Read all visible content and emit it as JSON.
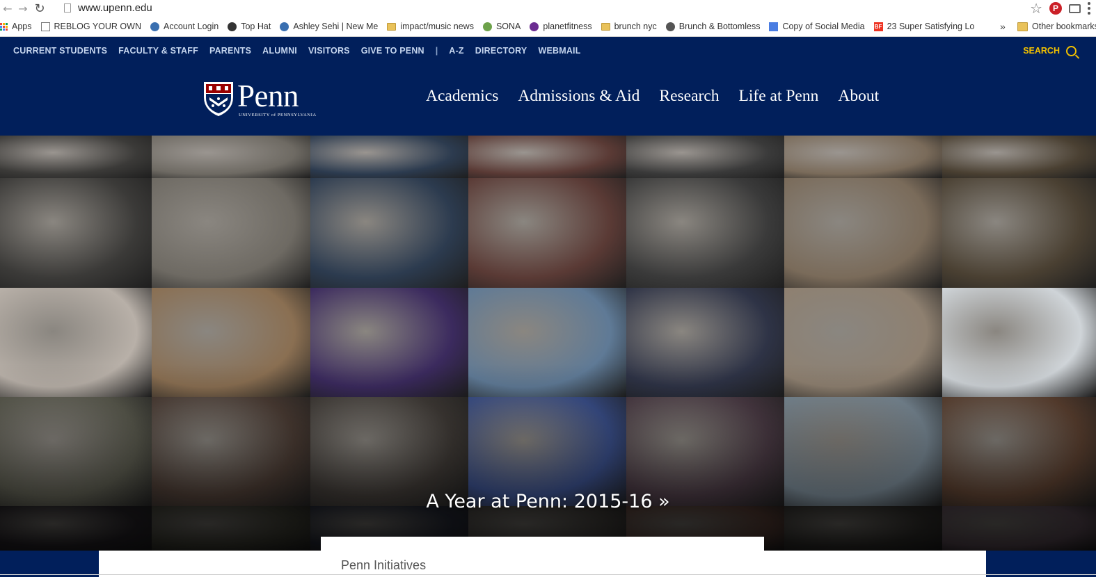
{
  "browser": {
    "url": "www.upenn.edu",
    "bookmarks": [
      {
        "label": "Apps",
        "icon": "apps-grid-icon"
      },
      {
        "label": "REBLOG YOUR OWN",
        "icon": "page-icon"
      },
      {
        "label": "Account Login",
        "icon": "globe-icon"
      },
      {
        "label": "Top Hat",
        "icon": "tophat-icon"
      },
      {
        "label": "Ashley Sehi | New Me",
        "icon": "globe-icon"
      },
      {
        "label": "impact/music news",
        "icon": "folder-icon"
      },
      {
        "label": "SONA",
        "icon": "sona-icon"
      },
      {
        "label": "planetfitness",
        "icon": "planetfitness-icon"
      },
      {
        "label": "brunch nyc",
        "icon": "folder-icon"
      },
      {
        "label": "Brunch & Bottomless",
        "icon": "site-icon"
      },
      {
        "label": "Copy of Social Media",
        "icon": "doc-icon"
      },
      {
        "label": "23 Super Satisfying Lo",
        "icon": "buzzfeed-icon"
      }
    ],
    "more": "»",
    "other_bookmarks": "Other bookmarks"
  },
  "utility_nav": {
    "links": [
      "CURRENT STUDENTS",
      "FACULTY & STAFF",
      "PARENTS",
      "ALUMNI",
      "VISITORS",
      "GIVE TO PENN"
    ],
    "separator": "|",
    "links_after": [
      "A-Z",
      "DIRECTORY",
      "WEBMAIL"
    ],
    "search_label": "SEARCH"
  },
  "header": {
    "logo_word": "Penn",
    "logo_subtitle": "UNIVERSITY of PENNSYLVANIA",
    "nav": [
      "Academics",
      "Admissions & Aid",
      "Research",
      "Life at Penn",
      "About"
    ]
  },
  "hero": {
    "caption": "A Year at Penn: 2015-16 »"
  },
  "initiatives": {
    "title": "Penn Initiatives"
  },
  "colors": {
    "penn_blue": "#011f5b",
    "search_yellow": "#f2c100",
    "penn_red": "#990000"
  }
}
